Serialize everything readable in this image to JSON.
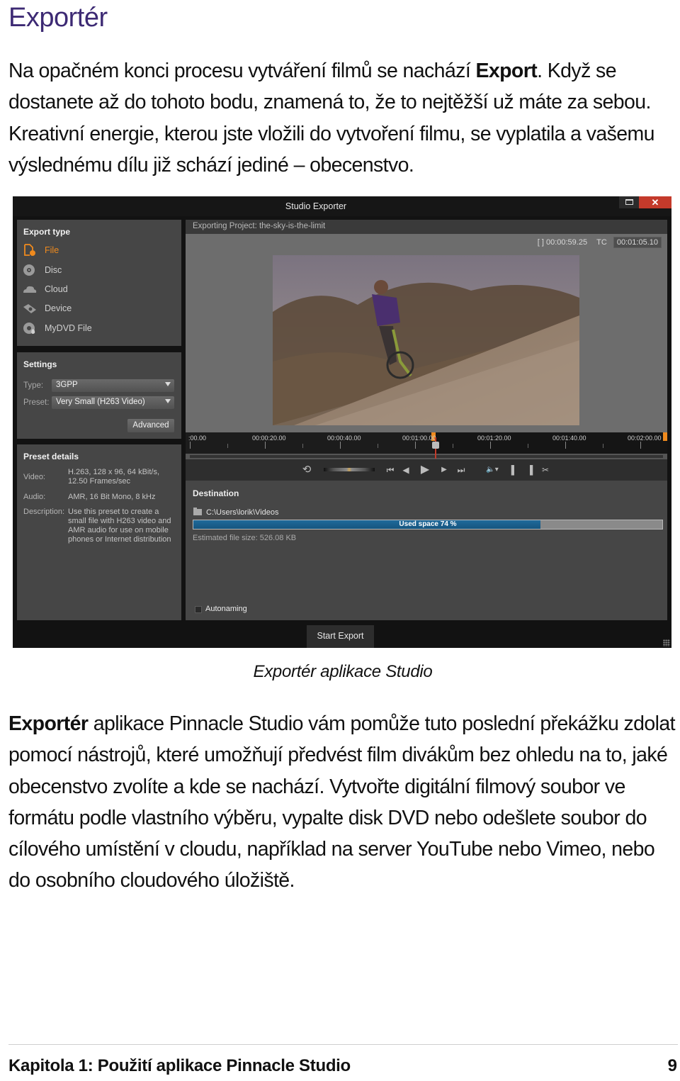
{
  "page": {
    "title": "Exportér",
    "intro_parts": [
      "Na opačném konci procesu vytváření filmů se nachází ",
      "Export",
      ". Když se dostanete až do tohoto bodu, znamená to, že to nejtěžší už máte za sebou. Kreativní energie, kterou jste vložili do vytvoření filmu, se vyplatila a vašemu výslednému dílu již schází jediné – obecenstvo."
    ],
    "caption": "Exportér aplikace Studio",
    "body_parts": [
      "Exportér",
      " aplikace Pinnacle Studio vám pomůže tuto poslední překážku zdolat pomocí nástrojů, které umožňují předvést film divákům bez ohledu na to, jaké obecenstvo zvolíte a kde se nachází. Vytvořte digitální filmový soubor ve formátu podle vlastního výběru, vypalte disk DVD nebo odešlete soubor do cílového umístění v cloudu, například na server YouTube nebo Vimeo, nebo do osobního cloudového úložiště."
    ],
    "footer": {
      "chapter": "Kapitola 1: Použití aplikace Pinnacle Studio",
      "page_number": "9"
    }
  },
  "exporter": {
    "window_title": "Studio Exporter",
    "close_glyph": "✕",
    "export_type": {
      "heading": "Export type",
      "items": [
        {
          "label": "File",
          "icon": "file-export-icon",
          "active": true
        },
        {
          "label": "Disc",
          "icon": "disc-icon",
          "active": false
        },
        {
          "label": "Cloud",
          "icon": "cloud-icon",
          "active": false
        },
        {
          "label": "Device",
          "icon": "device-icon",
          "active": false
        },
        {
          "label": "MyDVD File",
          "icon": "mydvd-icon",
          "active": false
        }
      ]
    },
    "settings": {
      "heading": "Settings",
      "type_label": "Type:",
      "type_value": "3GPP",
      "preset_label": "Preset:",
      "preset_value": "Very Small (H263 Video)",
      "advanced_label": "Advanced"
    },
    "preset_details": {
      "heading": "Preset details",
      "video_label": "Video:",
      "video_value": "H.263, 128 x 96, 64 kBit/s, 12.50 Frames/sec",
      "audio_label": "Audio:",
      "audio_value": "AMR, 16 Bit Mono, 8 kHz",
      "description_label": "Description:",
      "description_value": "Use this preset to create a small file with H263 video and AMR audio for use on mobile phones or Internet distribution"
    },
    "project": "Exporting Project: the-sky-is-the-limit",
    "duration": "[ ] 00:00:59.25",
    "tc_label": "TC",
    "tc_value": "00:01:05.10",
    "timeline": {
      "labels": [
        ":00.00",
        "00:00:20.00",
        "00:00:40.00",
        "00:01:00.00",
        "00:01:20.00",
        "00:01:40.00",
        "00:02:00.00"
      ]
    },
    "transport": {
      "loop": "⟲",
      "go_start": "⏮",
      "step_back": "◀",
      "play": "▶",
      "step_forward": "▶",
      "go_end": "⏭",
      "volume": "🔈▾",
      "mark_in": "▌",
      "mark_out": "▐",
      "clear_marks": "✂"
    },
    "destination": {
      "heading": "Destination",
      "path": "C:\\Users\\lorik\\Videos",
      "used_space_label": "Used space 74 %",
      "used_space_percent": 74,
      "estimated_size": "Estimated file size: 526.08 KB",
      "autonaming_label": "Autonaming",
      "autonaming_checked": false
    },
    "start_export_label": "Start Export"
  }
}
